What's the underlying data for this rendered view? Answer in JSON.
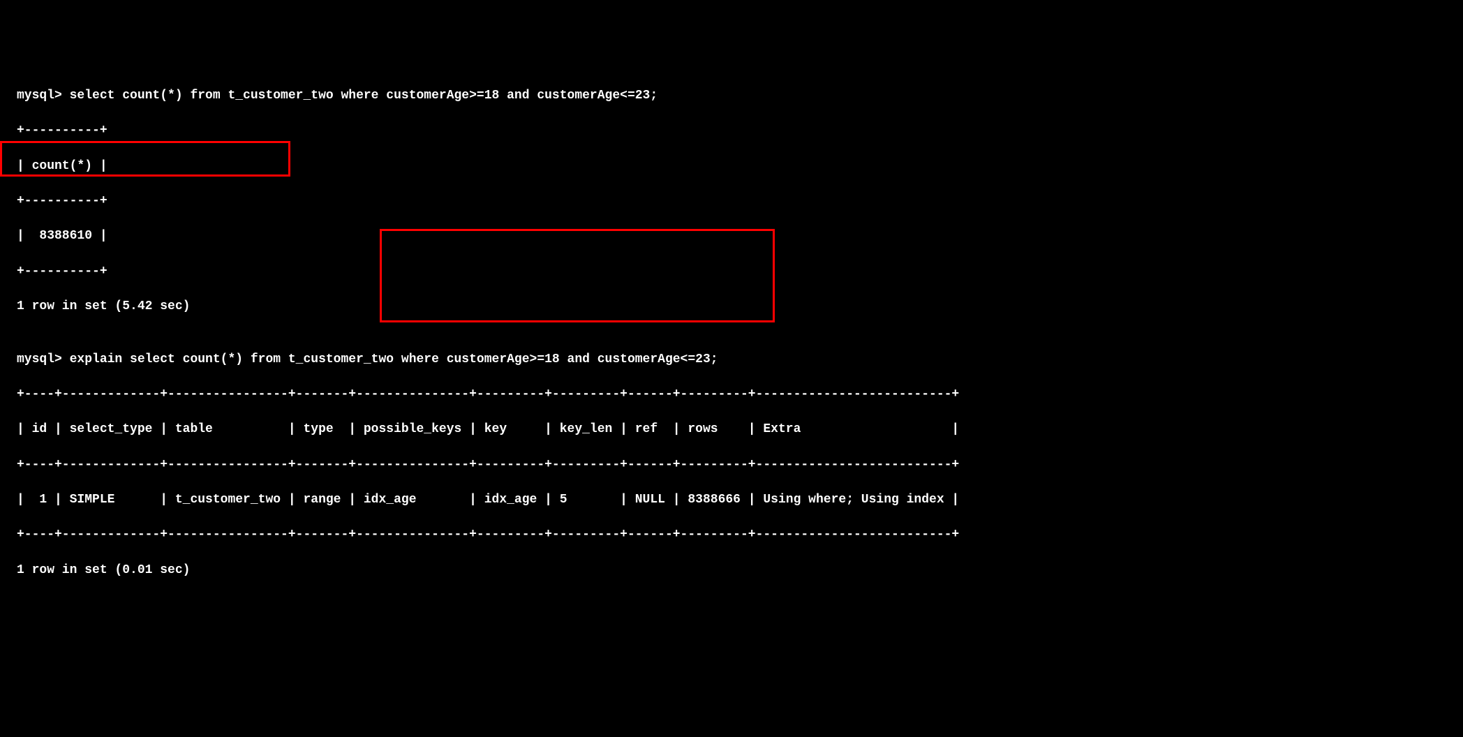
{
  "lines": {
    "l1": "mysql> select count(*) from t_customer_two where customerAge>=18 and customerAge<=23;",
    "l2": "+----------+",
    "l3": "| count(*) |",
    "l4": "+----------+",
    "l5": "|  8388610 |",
    "l6": "+----------+",
    "l7": "1 row in set (5.42 sec)",
    "l8": "",
    "l9": "mysql> explain select count(*) from t_customer_two where customerAge>=18 and customerAge<=23;",
    "l10": "+----+-------------+----------------+-------+---------------+---------+---------+------+---------+--------------------------+",
    "l11": "| id | select_type | table          | type  | possible_keys | key     | key_len | ref  | rows    | Extra                    |",
    "l12": "+----+-------------+----------------+-------+---------------+---------+---------+------+---------+--------------------------+",
    "l13": "|  1 | SIMPLE      | t_customer_two | range | idx_age       | idx_age | 5       | NULL | 8388666 | Using where; Using index |",
    "l14": "+----+-------------+----------------+-------+---------------+---------+---------+------+---------+--------------------------+",
    "l15": "1 row in set (0.01 sec)"
  },
  "chart_data": {
    "type": "table",
    "title": "MySQL terminal output",
    "query1": {
      "sql": "select count(*) from t_customer_two where customerAge>=18 and customerAge<=23;",
      "result_column": "count(*)",
      "result_value": 8388610,
      "rows_in_set": 1,
      "time_sec": 5.42
    },
    "query2": {
      "sql": "explain select count(*) from t_customer_two where customerAge>=18 and customerAge<=23;",
      "columns": [
        "id",
        "select_type",
        "table",
        "type",
        "possible_keys",
        "key",
        "key_len",
        "ref",
        "rows",
        "Extra"
      ],
      "row": {
        "id": 1,
        "select_type": "SIMPLE",
        "table": "t_customer_two",
        "type": "range",
        "possible_keys": "idx_age",
        "key": "idx_age",
        "key_len": 5,
        "ref": "NULL",
        "rows": 8388666,
        "Extra": "Using where; Using index"
      },
      "rows_in_set": 1,
      "time_sec": 0.01
    }
  }
}
